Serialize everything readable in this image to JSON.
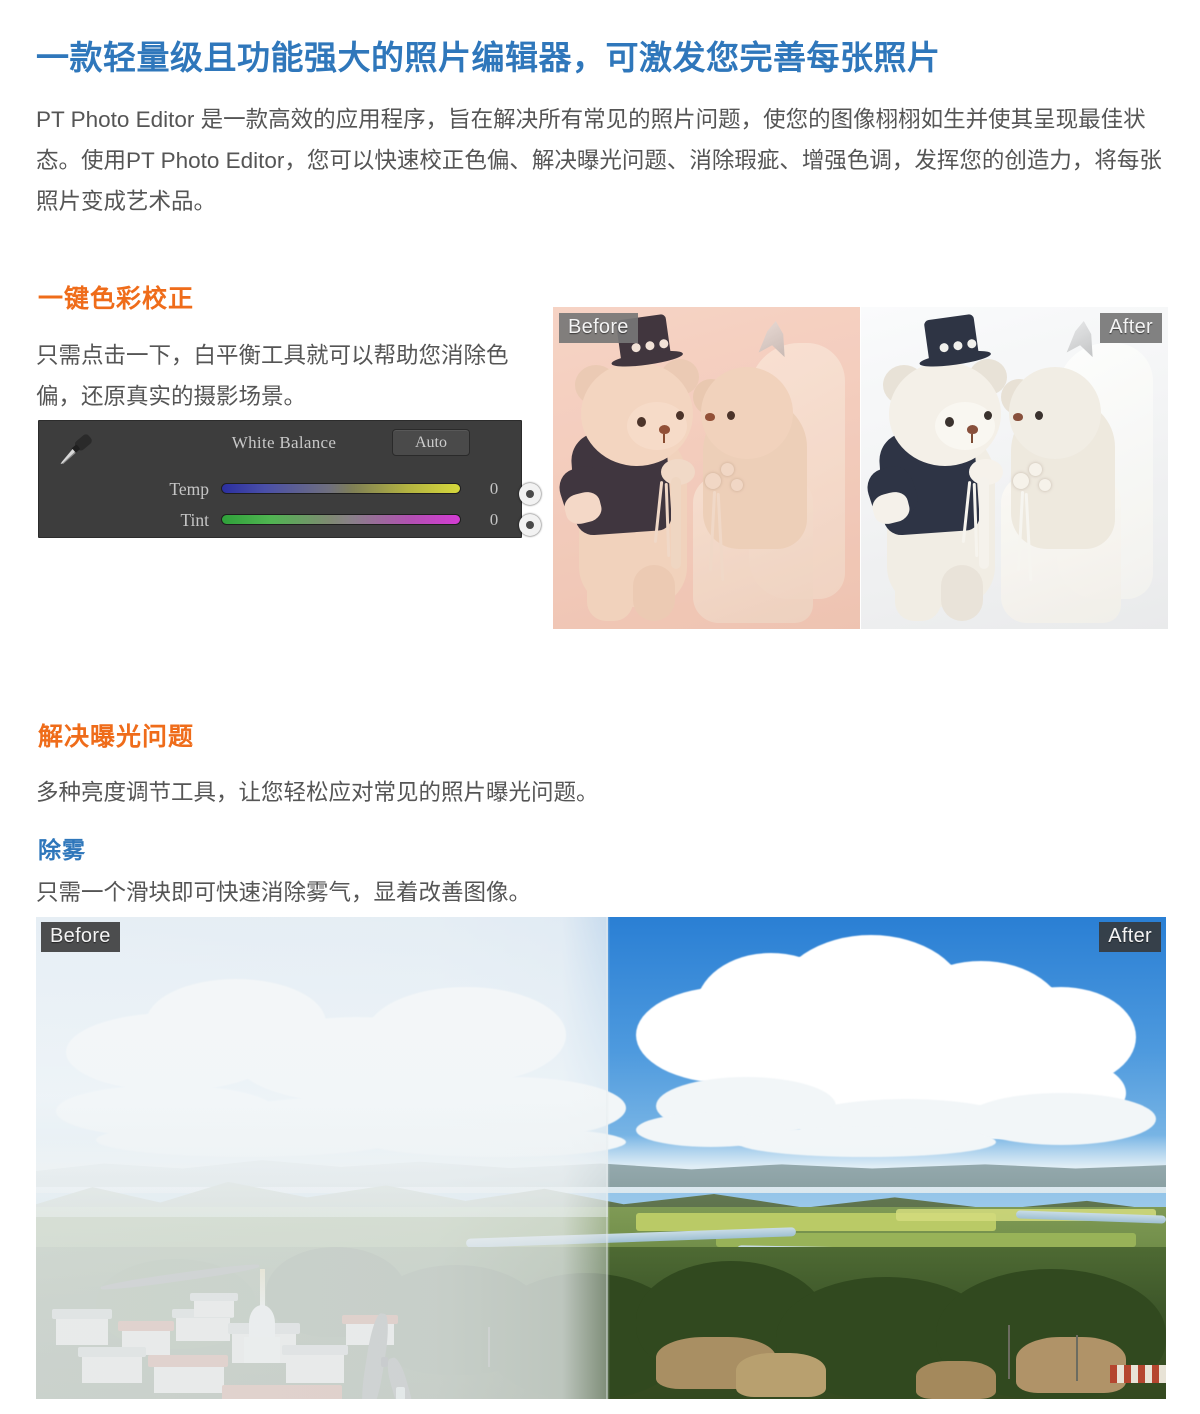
{
  "page": {
    "headline": "一款轻量级且功能强大的照片编辑器，可激发您完善每张照片",
    "intro": "PT Photo Editor 是一款高效的应用程序，旨在解决所有常见的照片问题，使您的图像栩栩如生并使其呈现最佳状态。使用PT Photo Editor，您可以快速校正色偏、解决曝光问题、消除瑕疵、增强色调，发挥您的创造力，将每张照片变成艺术品。"
  },
  "colors": {
    "headline_blue": "#2f77bb",
    "heading_orange": "#ef6c1a",
    "body_grey": "#555555",
    "panel_bg": "#3d3d3d"
  },
  "sections": [
    {
      "id": "color-correction",
      "heading": "一键色彩校正",
      "heading_color": "#ef6c1a",
      "body": "只需点击一下，白平衡工具就可以帮助您消除色偏，还原真实的摄影场景。"
    },
    {
      "id": "exposure",
      "heading": "解决曝光问题",
      "heading_color": "#ef6c1a",
      "body": "多种亮度调节工具，让您轻松应对常见的照片曝光问题。"
    },
    {
      "id": "dehaze",
      "heading": "除雾",
      "heading_color": "#2f77bb",
      "body": "只需一个滑块即可快速消除雾气，显着改善图像。"
    }
  ],
  "white_balance_panel": {
    "eyedropper_icon": "eyedropper-icon",
    "title": "White Balance",
    "auto_button": "Auto",
    "sliders": [
      {
        "label": "Temp",
        "value": "0",
        "position_percent": 50,
        "gradient_from": "blue",
        "gradient_to": "yellow"
      },
      {
        "label": "Tint",
        "value": "0",
        "position_percent": 50,
        "gradient_from": "green",
        "gradient_to": "magenta"
      }
    ]
  },
  "figures": [
    {
      "id": "bears-comparison",
      "before_label": "Before",
      "after_label": "After",
      "caption_subject": "wedding teddy bears",
      "before_tint": "warm pink color cast",
      "after_tint": "neutral white balance"
    },
    {
      "id": "landscape-comparison",
      "before_label": "Before",
      "after_label": "After",
      "caption_subject": "hazy grassland valley with village",
      "before_tint": "hazy low contrast",
      "after_tint": "clear blue sky, vivid green"
    }
  ]
}
